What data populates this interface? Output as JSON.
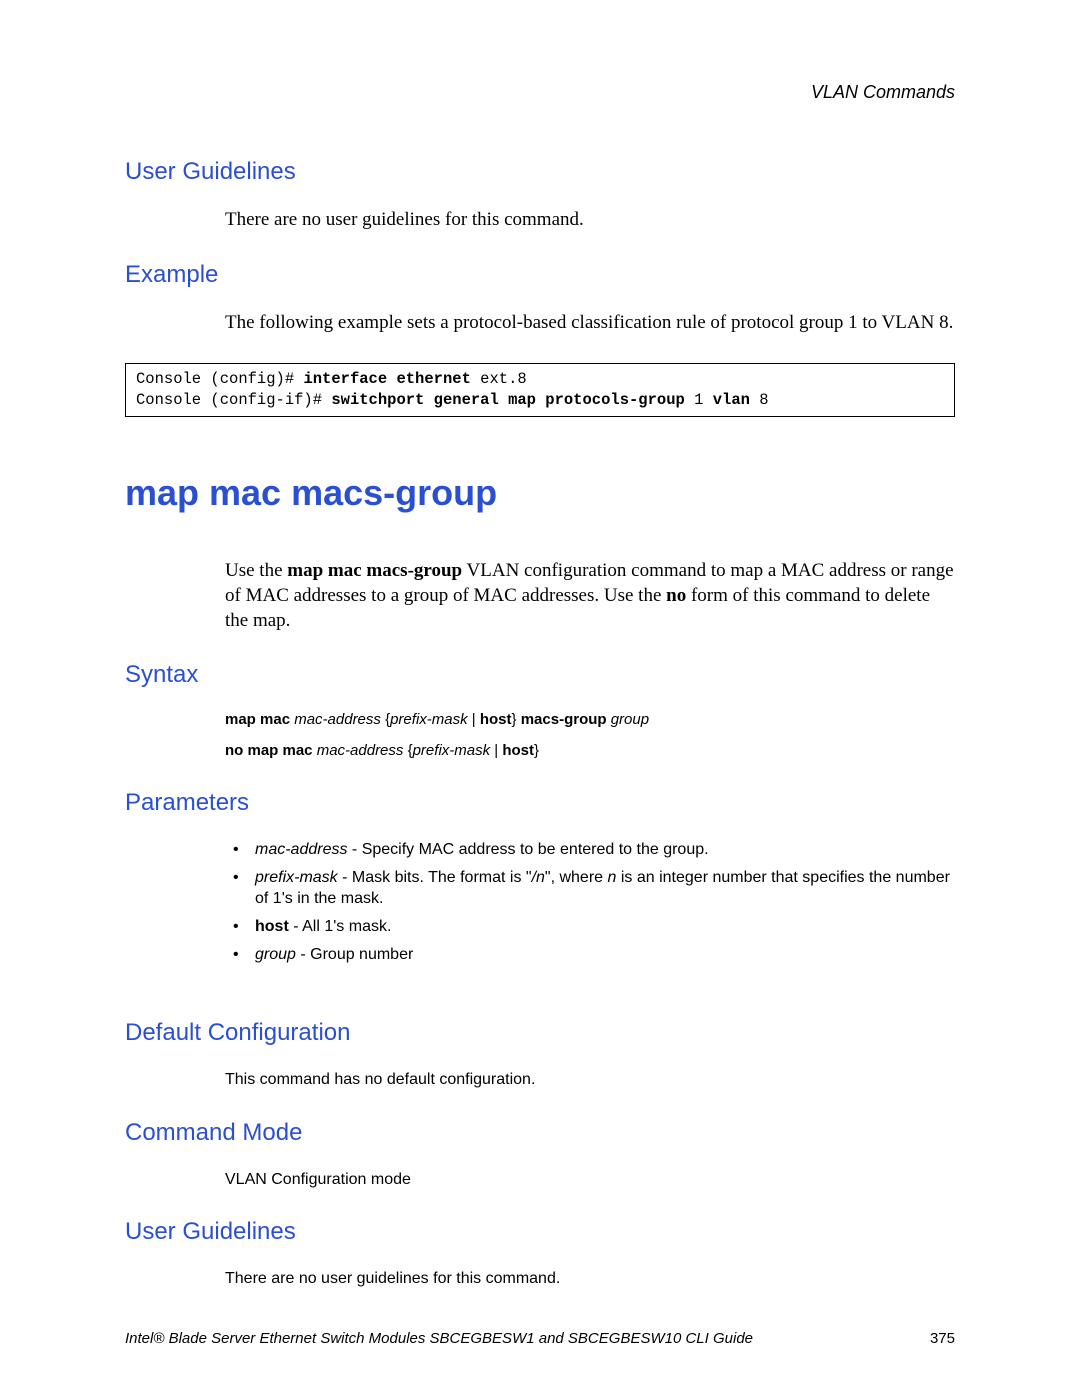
{
  "header": {
    "breadcrumb": "VLAN Commands"
  },
  "s1": {
    "heading_ug1": "User Guidelines",
    "ug1_body": "There are no user guidelines for this command.",
    "heading_ex": "Example",
    "ex_body": "The following example sets a protocol-based classification rule of protocol group 1 to VLAN 8."
  },
  "code": {
    "l1a": "Console (config)# ",
    "l1b": "interface ethernet",
    "l1c": " ext.8",
    "l2a": "Console (config-if)# ",
    "l2b": "switchport general map protocols-group",
    "l2c": " 1 ",
    "l2d": "vlan",
    "l2e": " 8"
  },
  "main": {
    "title": "map mac macs-group",
    "intro_a": "Use the ",
    "intro_b": "map mac macs-group",
    "intro_c": " VLAN configuration command to map a MAC address or range of MAC addresses to a group of MAC addresses. Use the ",
    "intro_d": "no",
    "intro_e": " form of this command to delete the map."
  },
  "syntax": {
    "heading": "Syntax",
    "l1_b1": "map mac ",
    "l1_i1": "mac-address",
    "l1_p1": " {",
    "l1_i2": "prefix-mask",
    "l1_p2": " | ",
    "l1_b2": "host",
    "l1_p3": "} ",
    "l1_b3": "macs-group ",
    "l1_i3": "group",
    "l2_b1": "no map mac ",
    "l2_i1": "mac-address",
    "l2_p1": " {",
    "l2_i2": "prefix-mask",
    "l2_p2": " | ",
    "l2_b2": "host",
    "l2_p3": "}"
  },
  "params": {
    "heading": "Parameters",
    "p1_i": "mac-address",
    "p1_t": " - Specify MAC address to be entered to the group.",
    "p2_i": "prefix-mask",
    "p2_t1": " - Mask bits. The format is \"",
    "p2_i2": "/n",
    "p2_t2": "\", where ",
    "p2_i3": "n",
    "p2_t3": " is an integer number that specifies the number of 1's in the mask.",
    "p3_b": "host",
    "p3_t": " - All 1's mask.",
    "p4_i": "group",
    "p4_t": " - Group number"
  },
  "dc": {
    "heading": "Default Configuration",
    "body": "This command has no default configuration."
  },
  "cm": {
    "heading": "Command Mode",
    "body": "VLAN Configuration mode"
  },
  "ug2": {
    "heading": "User Guidelines",
    "body": "There are no user guidelines for this command."
  },
  "footer": {
    "title": "Intel® Blade Server Ethernet Switch Modules SBCEGBESW1 and SBCEGBESW10 CLI Guide",
    "page": "375"
  }
}
